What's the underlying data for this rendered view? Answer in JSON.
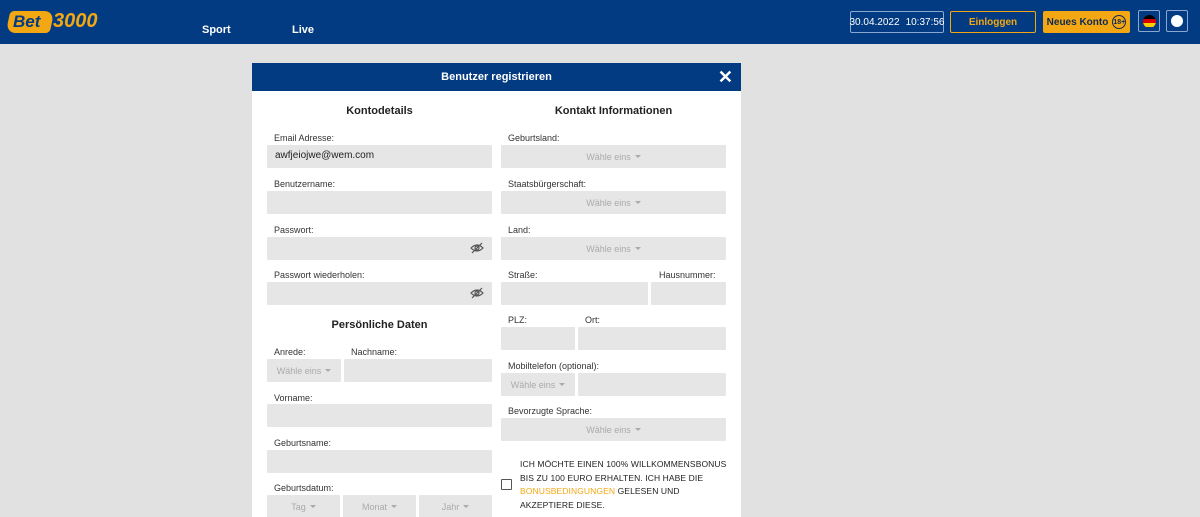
{
  "header": {
    "logo_text_a": "Bet",
    "logo_text_b": "3000",
    "nav": [
      "Sport",
      "Live"
    ],
    "date": "30.04.2022",
    "time": "10:37:56",
    "login_label": "Einloggen",
    "register_label": "Neues Konto",
    "age_badge": "18+",
    "brand_color": "#033b82",
    "accent_color": "#f3a712"
  },
  "modal": {
    "title": "Benutzer registrieren",
    "close_icon": "close-icon",
    "account": {
      "heading": "Kontodetails",
      "email_label": "Email Adresse:",
      "email_value": "awfjeiojwe@wem.com",
      "username_label": "Benutzername:",
      "password_label": "Passwort:",
      "password_repeat_label": "Passwort wiederholen:"
    },
    "personal": {
      "heading": "Persönliche Daten",
      "salutation_label": "Anrede:",
      "salutation_value": "Wähle eins",
      "lastname_label": "Nachname:",
      "firstname_label": "Vorname:",
      "birthname_label": "Geburtsname:",
      "birthdate_label": "Geburtsdatum:",
      "day": "Tag",
      "month": "Monat",
      "year": "Jahr"
    },
    "contact": {
      "heading": "Kontakt Informationen",
      "birth_country_label": "Geburtsland:",
      "citizenship_label": "Staatsbürgerschaft:",
      "country_label": "Land:",
      "street_label": "Straße:",
      "house_number_label": "Hausnummer:",
      "zip_label": "PLZ:",
      "city_label": "Ort:",
      "mobile_label": "Mobiltelefon (optional):",
      "language_label": "Bevorzugte Sprache:",
      "select_placeholder": "Wähle eins"
    },
    "bonus": {
      "text_before": "ICH MÖCHTE EINEN 100% WILLKOMMENSBONUS BIS ZU 100 EURO ERHALTEN. ICH HABE DIE ",
      "link_text": "BONUSBEDINGUNGEN",
      "text_after": " GELESEN UND AKZEPTIERE DIESE."
    }
  }
}
